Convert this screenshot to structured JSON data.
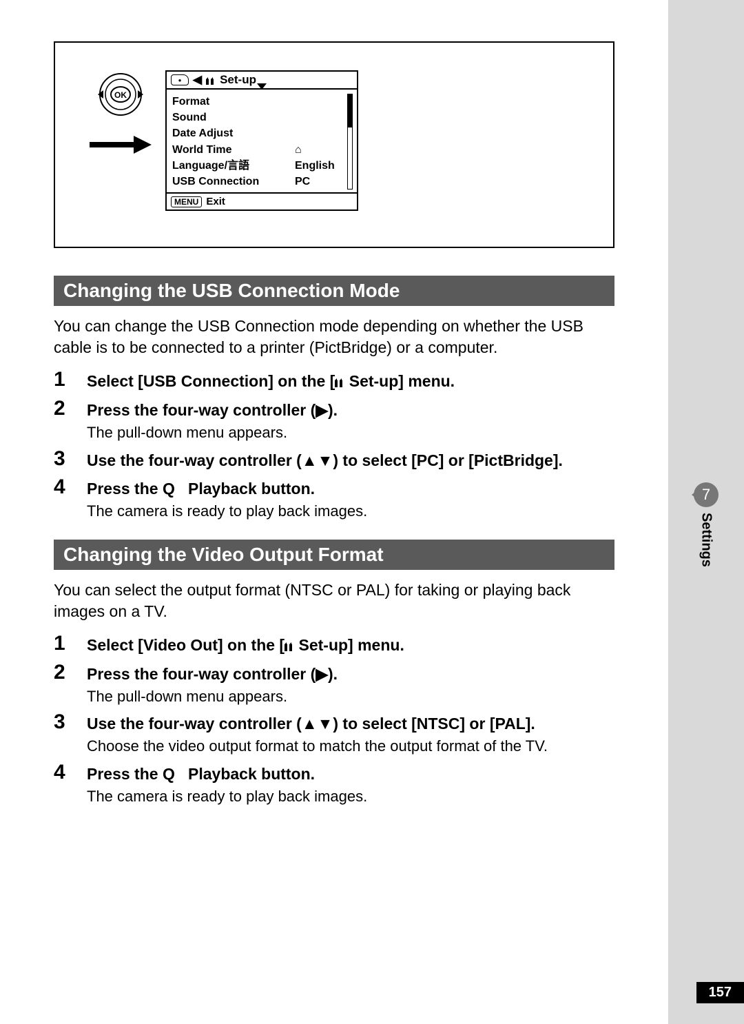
{
  "lcd": {
    "title": "Set-up",
    "items": [
      {
        "label": "Format",
        "value": ""
      },
      {
        "label": "Sound",
        "value": ""
      },
      {
        "label": "Date Adjust",
        "value": ""
      },
      {
        "label": "World Time",
        "value": "⌂"
      },
      {
        "label": "Language/言語",
        "value": "English"
      },
      {
        "label": "USB Connection",
        "value": "PC"
      }
    ],
    "footer_btn": "MENU",
    "footer_label": "Exit"
  },
  "section1": {
    "heading": "Changing the USB Connection Mode",
    "intro": "You can change the USB Connection mode depending on whether the USB cable is to be connected to a printer (PictBridge) or a computer.",
    "steps": [
      {
        "title_pre": "Select [USB Connection] on the [",
        "title_post": " Set-up] menu.",
        "sub": ""
      },
      {
        "title_pre": "Press the four-way controller (",
        "title_post": ").",
        "glyph": "▶",
        "sub": "The pull-down menu appears."
      },
      {
        "title_pre": "Use the four-way controller (",
        "title_post": ") to select [PC] or [PictBridge].",
        "glyph": "▲▼",
        "sub": ""
      },
      {
        "title_pre": "Press the ",
        "title_mid": " Playback button.",
        "glyph": "Q",
        "sub": "The camera is ready to play back images."
      }
    ]
  },
  "section2": {
    "heading": "Changing the Video Output Format",
    "intro": "You can select the output format (NTSC or PAL) for taking or playing back images on a TV.",
    "steps": [
      {
        "title_pre": "Select [Video Out] on the [",
        "title_post": " Set-up] menu.",
        "sub": ""
      },
      {
        "title_pre": "Press the four-way controller (",
        "title_post": ").",
        "glyph": "▶",
        "sub": "The pull-down menu appears."
      },
      {
        "title_pre": "Use the four-way controller (",
        "title_post": ") to select [NTSC] or [PAL].",
        "glyph": "▲▼",
        "sub": "Choose the video output format to match the output format of the TV."
      },
      {
        "title_pre": "Press the ",
        "title_mid": " Playback button.",
        "glyph": "Q",
        "sub": "The camera is ready to play back images."
      }
    ]
  },
  "side": {
    "chapter": "7",
    "label": "Settings"
  },
  "page_number": "157"
}
